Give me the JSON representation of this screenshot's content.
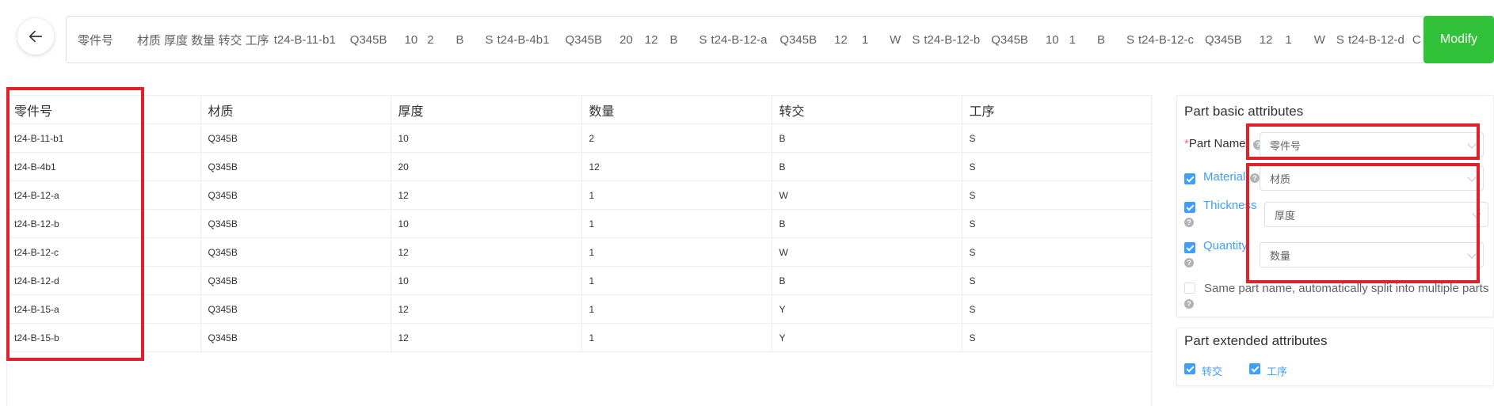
{
  "top_bar": {
    "segments": [
      "零件号",
      "材质 厚度 数量 转交 工序",
      "t24-B-11-b1",
      "Q345B",
      "10",
      "2",
      "B",
      "S",
      "t24-B-4b1",
      "Q345B",
      "20",
      "12",
      "B",
      "S",
      "t24-B-12-a",
      "Q345B",
      "12",
      "1",
      "W",
      "S",
      "t24-B-12-b",
      "Q345B",
      "10",
      "1",
      "B",
      "S",
      "t24-B-12-c",
      "Q345B",
      "12",
      "1",
      "W",
      "S",
      "t24-B-12-d",
      "C"
    ],
    "modify_label": "Modify"
  },
  "table": {
    "headers": [
      "零件号",
      "材质",
      "厚度",
      "数量",
      "转交",
      "工序"
    ],
    "rows": [
      [
        "t24-B-11-b1",
        "Q345B",
        "10",
        "2",
        "B",
        "S"
      ],
      [
        "t24-B-4b1",
        "Q345B",
        "20",
        "12",
        "B",
        "S"
      ],
      [
        "t24-B-12-a",
        "Q345B",
        "12",
        "1",
        "W",
        "S"
      ],
      [
        "t24-B-12-b",
        "Q345B",
        "10",
        "1",
        "B",
        "S"
      ],
      [
        "t24-B-12-c",
        "Q345B",
        "12",
        "1",
        "W",
        "S"
      ],
      [
        "t24-B-12-d",
        "Q345B",
        "10",
        "1",
        "B",
        "S"
      ],
      [
        "t24-B-15-a",
        "Q345B",
        "12",
        "1",
        "Y",
        "S"
      ],
      [
        "t24-B-15-b",
        "Q345B",
        "12",
        "1",
        "Y",
        "S"
      ]
    ]
  },
  "basic": {
    "title": "Part basic attributes",
    "part_name_label": "Part Name",
    "part_name_value": "零件号",
    "material_label": "Material",
    "material_value": "材质",
    "thickness_label": "Thickness",
    "thickness_value": "厚度",
    "quantity_label": "Quantity",
    "quantity_value": "数量",
    "split_label": "Same part name, automatically split into multiple parts"
  },
  "extended": {
    "title": "Part extended attributes",
    "items": [
      "转交",
      "工序"
    ]
  },
  "colors": {
    "accent": "#409eff",
    "modify": "#31c23a",
    "highlight": "#e0202a"
  }
}
